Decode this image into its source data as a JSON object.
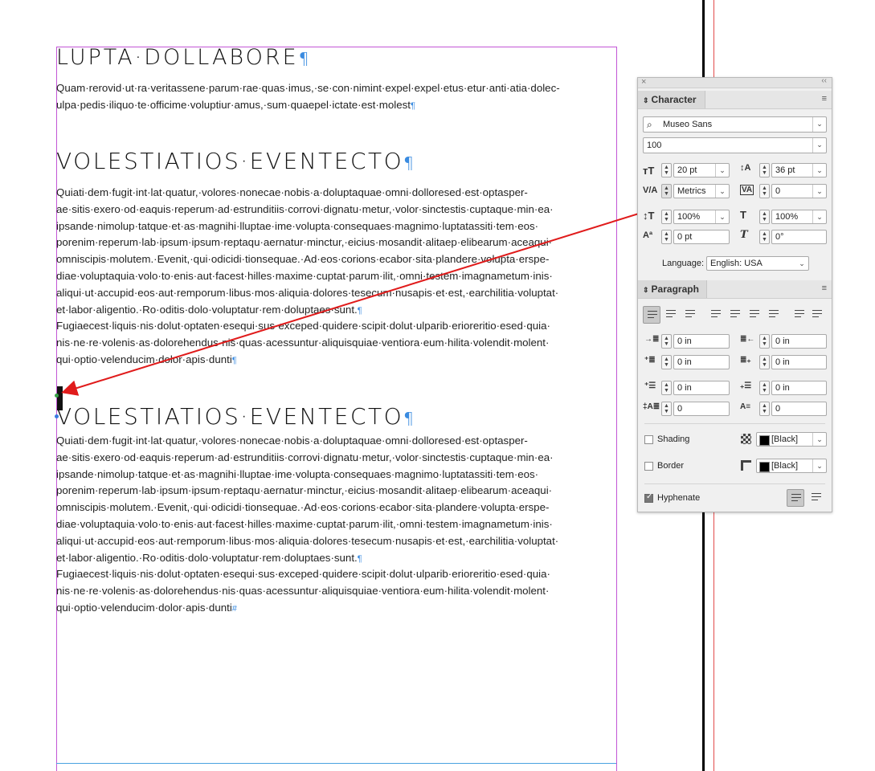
{
  "document": {
    "heading1": "LUPTA·DOLLABORE",
    "pilcrow": "¶",
    "para1": [
      "Quam·rerovid·ut·ra·veritassene·parum·rae·quas·imus,·se·con·nimint·expel·expel·etus·etur·anti·atia·dolec-",
      "ulpa·pedis·iliquo·te·officime·voluptiur·amus,·sum·quaepel·ictate·est·molest"
    ],
    "heading2": "VOLESTIATIOS·EVENTECTO",
    "heading3": "VOLESTIATIOS·EVENTECTO",
    "para2": [
      "Quiati·dem·fugit·int·lat·quatur,·volores·nonecae·nobis·a·doluptaquae·omni·dolloresed·est·optasper-",
      "ae·sitis·exero·od·eaquis·reperum·ad·estrunditiis·corrovi·dignatu·metur,·volor·sinctestis·cuptaque·min·ea·",
      "ipsande·nimolup·tatque·et·as·magnihi·lluptae·ime·volupta·consequaes·magnimo·luptatassiti·tem·eos·",
      "porenim·reperum·lab·ipsum·ipsum·reptaqu·aernatur·minctur,·eicius·mosandit·alitaep·elibearum·aceaqui·",
      "omniscipis·molutem.·Evenit,·qui·odicidi·tionsequae.·Ad·eos·corions·ecabor·sita·plandere·volupta·erspe-",
      "diae·voluptaquia·volo·to·enis·aut·facest·hilles·maxime·cuptat·parum·ilit,·omni·testem·imagnametum·inis·",
      "aliqui·ut·accupid·eos·aut·remporum·libus·mos·aliquia·dolores·tesecum·nusapis·et·est,·earchilitia·voluptat·",
      "et·labor·aligentio.·Ro·oditis·dolo·voluptatur·rem·doluptaes·sunt."
    ],
    "para3": [
      "Fugiaecest·liquis·nis·dolut·optaten·esequi·sus·exceped·quidere·scipit·dolut·ulparib·erioreritio·esed·quia·",
      "nis·ne·re·volenis·as·dolorehendus·nis·quas·acessuntur·aliquisquiae·ventiora·eum·hilita·volendit·molent·",
      "qui·optio·velenducim·dolor·apis·dunti"
    ],
    "end_mark": "#"
  },
  "character_panel": {
    "tab_label": "Character",
    "font_family": "Museo Sans",
    "font_style": "100",
    "font_size": "20 pt",
    "leading": "36 pt",
    "kerning": "Metrics",
    "tracking": "0",
    "vertical_scale": "100%",
    "horizontal_scale": "100%",
    "baseline_shift": "0 pt",
    "skew": "0°",
    "language_label": "Language:",
    "language": "English: USA"
  },
  "paragraph_panel": {
    "tab_label": "Paragraph",
    "left_indent": "0 in",
    "right_indent": "0 in",
    "first_line_indent": "0 in",
    "last_line_indent": "0 in",
    "space_before": "0 in",
    "space_after": "0 in",
    "drop_cap_lines": "0",
    "drop_cap_chars": "0",
    "shading_label": "Shading",
    "shading_color": "[Black]",
    "border_label": "Border",
    "border_color": "[Black]",
    "hyphenate_label": "Hyphenate",
    "hyphenate_checked": true
  },
  "colors": {
    "annotation": "#e01b1b",
    "margin_guide": "#c256d6",
    "hidden_chars": "#3a8be0"
  }
}
